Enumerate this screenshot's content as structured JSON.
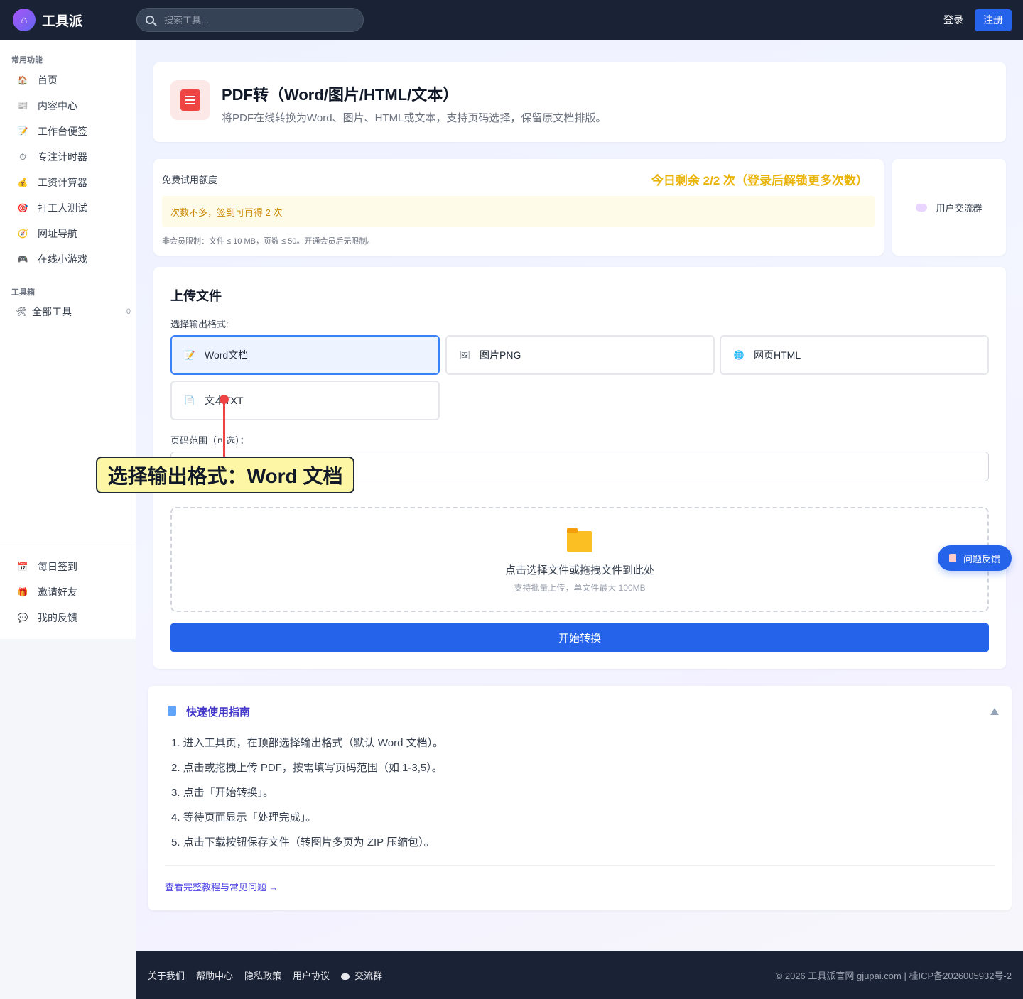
{
  "header": {
    "brand": "工具派",
    "search_placeholder": "搜索工具...",
    "login": "登录",
    "register": "注册"
  },
  "sidebar": {
    "section_common": "常用功能",
    "common_items": [
      {
        "label": "首页",
        "icon": "home-icon"
      },
      {
        "label": "内容中心",
        "icon": "news-icon"
      },
      {
        "label": "工作台便签",
        "icon": "memo-icon"
      },
      {
        "label": "专注计时器",
        "icon": "stopwatch-icon"
      },
      {
        "label": "工资计算器",
        "icon": "money-bag-icon"
      },
      {
        "label": "打工人测试",
        "icon": "target-icon"
      },
      {
        "label": "网址导航",
        "icon": "compass-icon"
      },
      {
        "label": "在线小游戏",
        "icon": "gamepad-icon"
      }
    ],
    "section_toolbox": "工具箱",
    "toolbox_item": {
      "label": "全部工具",
      "count": "0",
      "icon": "tools-icon"
    },
    "bottom_items": [
      {
        "label": "每日签到",
        "icon": "calendar-icon"
      },
      {
        "label": "邀请好友",
        "icon": "gift-icon"
      },
      {
        "label": "我的反馈",
        "icon": "speech-bubble-icon"
      }
    ]
  },
  "title_card": {
    "title": "PDF转（Word/图片/HTML/文本）",
    "subtitle": "将PDF在线转换为Word、图片、HTML或文本，支持页码选择，保留原文档排版。"
  },
  "quota": {
    "label": "免费试用额度",
    "remaining": "今日剩余 2/2 次（登录后解锁更多次数）",
    "tip": "次数不多，签到可再得 2 次",
    "note": "非会员限制：文件 ≤ 10 MB，页数 ≤ 50。开通会员后无限制。"
  },
  "group": {
    "label": "用户交流群"
  },
  "upload": {
    "title": "上传文件",
    "format_label": "选择输出格式:",
    "formats": [
      {
        "label": "Word文档",
        "icon": "word-doc-icon",
        "selected": true
      },
      {
        "label": "图片PNG",
        "icon": "image-icon",
        "selected": false
      },
      {
        "label": "网页HTML",
        "icon": "globe-icon",
        "selected": false
      },
      {
        "label": "文本TXT",
        "icon": "text-file-icon",
        "selected": false
      }
    ],
    "page_range_label": "页码范围（可选）：",
    "page_range_placeholder": "",
    "drop_main": "点击选择文件或拖拽文件到此处",
    "drop_sub": "支持批量上传，单文件最大 100MB",
    "convert": "开始转换"
  },
  "feedback_button": "问题反馈",
  "guide": {
    "title": "快速使用指南",
    "steps": [
      "1. 进入工具页，在顶部选择输出格式（默认 Word 文档）。",
      "2. 点击或拖拽上传 PDF，按需填写页码范围（如 1-3,5）。",
      "3. 点击「开始转换」。",
      "4. 等待页面显示「处理完成」。",
      "5. 点击下载按钮保存文件（转图片多页为 ZIP 压缩包）。"
    ],
    "link": "查看完整教程与常见问题 →"
  },
  "footer": {
    "links": [
      "关于我们",
      "帮助中心",
      "隐私政策",
      "用户协议"
    ],
    "chat": "交流群",
    "copyright": "© 2026 工具派官网 gjupai.com | 桂ICP备2026005932号-2"
  },
  "annotation": {
    "text": "选择输出格式：Word 文档"
  },
  "colors": {
    "primary": "#2563eb",
    "header_bg": "#1a2235",
    "quota_highlight": "#eab308",
    "annotation_bg": "#fdf6a4",
    "annotation_marker": "#ef4444"
  }
}
